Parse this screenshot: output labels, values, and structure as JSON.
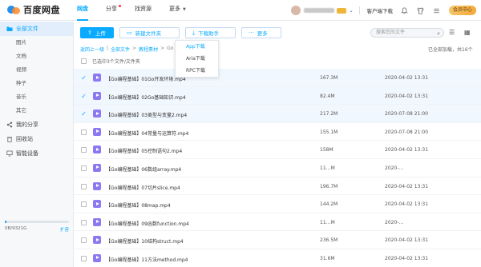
{
  "brand": {
    "name": "百度网盘"
  },
  "nav": [
    {
      "label": "网盘",
      "active": true
    },
    {
      "label": "分享",
      "dot": true
    },
    {
      "label": "找资源"
    },
    {
      "label": "更多",
      "caret": true
    }
  ],
  "top_right": {
    "client_download": "客户端下载",
    "member": "会员中心"
  },
  "sidebar": {
    "all_files": "全部文件",
    "categories": [
      "图片",
      "文档",
      "视频",
      "种子",
      "音乐",
      "其它"
    ],
    "bottom": [
      "我的分享",
      "回收站",
      "智能设备"
    ],
    "storage": {
      "used": "0B/9321G",
      "upgrade": "扩容",
      "fill_fraction": 0.02
    }
  },
  "toolbar": {
    "upload": "上传",
    "new_folder": "新建文件夹",
    "download_helper": "下载助手",
    "more": "更多",
    "search_placeholder": "搜索您的文件"
  },
  "breadcrumb": [
    "返回上一级",
    "全部文件",
    "教程素材",
    "Go"
  ],
  "loaded_info": "已全部加载，共16个",
  "selected_info": "已选中3个文件/文件夹",
  "dropdown": [
    "App下载",
    "Aria下载",
    "RPC下载"
  ],
  "files": [
    {
      "name": "【Go编程基础】01Go开发环境.mp4",
      "size": "167.3M",
      "date": "2020-04-02 13:31",
      "checked": true
    },
    {
      "name": "【Go编程基础】02Go基础知识.mp4",
      "size": "82.4M",
      "date": "2020-04-02 13:31",
      "checked": true
    },
    {
      "name": "【Go编程基础】03类型与变量2.mp4",
      "size": "217.2M",
      "date": "2020-07-08 21:00",
      "checked": true
    },
    {
      "name": "【Go编程基础】04常量与运算符.mp4",
      "size": "155.1M",
      "date": "2020-07-08 21:00",
      "checked": false
    },
    {
      "name": "【Go编程基础】05控制语句2.mp4",
      "size": "158M",
      "date": "2020-04-02 13:31",
      "checked": false
    },
    {
      "name": "【Go编程基础】06数组array.mp4",
      "size": "11…M",
      "date": "2020-…",
      "checked": false
    },
    {
      "name": "【Go编程基础】07切片slice.mp4",
      "size": "196.7M",
      "date": "2020-04-02 13:31",
      "checked": false
    },
    {
      "name": "【Go编程基础】08map.mp4",
      "size": "144.2M",
      "date": "2020-04-02 13:31",
      "checked": false
    },
    {
      "name": "【Go编程基础】09函数function.mp4",
      "size": "11…M",
      "date": "2020-…",
      "checked": false
    },
    {
      "name": "【Go编程基础】10结构struct.mp4",
      "size": "236.5M",
      "date": "2020-04-02 13:31",
      "checked": false
    },
    {
      "name": "【Go编程基础】11方法method.mp4",
      "size": "31.6M",
      "date": "2020-04-02 13:31",
      "checked": false
    }
  ]
}
